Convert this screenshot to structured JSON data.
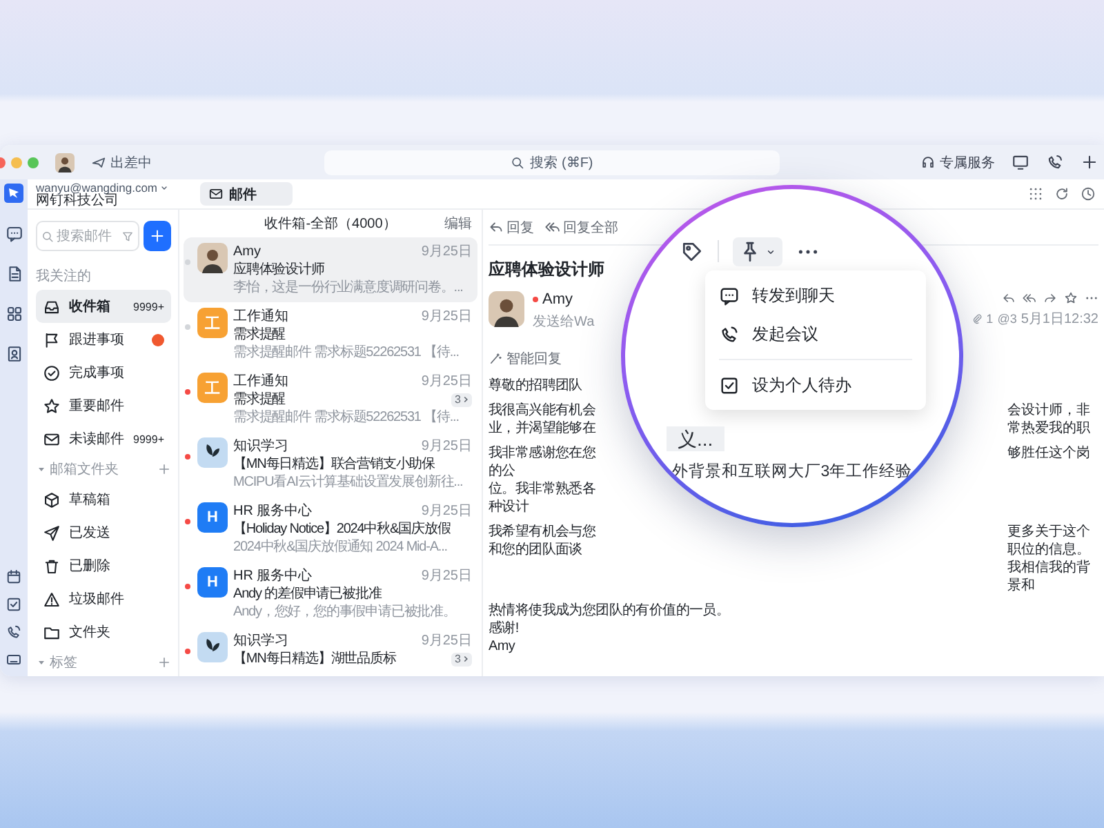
{
  "titlebar": {
    "status": "出差中",
    "search_placeholder": "搜索 (⌘F)",
    "service": "专属服务"
  },
  "account": {
    "email": "wanyu@wangding.com",
    "company": "网钉科技公司",
    "tabs": [
      {
        "label": "邮件",
        "selected": true
      }
    ]
  },
  "sidebar": {
    "search_placeholder": "搜索邮件",
    "sections": [
      {
        "title": "我关注的",
        "collapsible": false,
        "items": [
          {
            "kind": "inbox",
            "label": "收件箱",
            "count": "9999+",
            "alert": false,
            "selected": true
          },
          {
            "kind": "flag",
            "label": "跟进事项",
            "alert": true,
            "selected": false
          },
          {
            "kind": "done",
            "label": "完成事项",
            "alert": false,
            "selected": false
          },
          {
            "kind": "star",
            "label": "重要邮件",
            "alert": false,
            "selected": false
          },
          {
            "kind": "unread",
            "label": "未读邮件",
            "count": "9999+",
            "alert": false,
            "selected": false
          }
        ]
      },
      {
        "title": "邮箱文件夹",
        "collapsible": true,
        "items": [
          {
            "kind": "drafts",
            "label": "草稿箱",
            "alert": false,
            "selected": false
          },
          {
            "kind": "sent",
            "label": "已发送",
            "alert": false,
            "selected": false
          },
          {
            "kind": "trash",
            "label": "已删除",
            "alert": false,
            "selected": false
          },
          {
            "kind": "spam",
            "label": "垃圾邮件",
            "alert": false,
            "selected": false
          },
          {
            "kind": "folder",
            "label": "文件夹",
            "alert": false,
            "selected": false
          }
        ]
      },
      {
        "title": "标签",
        "collapsible": true
      }
    ]
  },
  "mail_list": {
    "title": "收件箱-全部（4000）",
    "edit": "编辑",
    "items": [
      {
        "sender": "Amy",
        "date": "9月25日",
        "subject": "应聘体验设计师",
        "preview": "李怡，这是一份行业满意度调研问卷。...",
        "avatar": {
          "kind": "photo"
        },
        "unread": false,
        "selected": true
      },
      {
        "sender": "工作通知",
        "date": "9月25日",
        "subject": "需求提醒",
        "preview": "需求提醒邮件 需求标题52262531 【待...",
        "avatar": {
          "kind": "letter",
          "text": "工",
          "color": "#f7a133"
        },
        "unread": false,
        "selected": false
      },
      {
        "sender": "工作通知",
        "date": "9月25日",
        "subject": "需求提醒",
        "count": "3",
        "preview": "需求提醒邮件 需求标题52262531 【待...",
        "avatar": {
          "kind": "letter",
          "text": "工",
          "color": "#f7a133"
        },
        "unread": true,
        "selected": false
      },
      {
        "sender": "知识学习",
        "date": "9月25日",
        "subject": "【MN每日精选】联合营销支小助保",
        "preview": "MCIPU看AI云计算基础设置发展创新往...",
        "avatar": {
          "kind": "picture"
        },
        "unread": true,
        "selected": false
      },
      {
        "sender": "HR 服务中心",
        "date": "9月25日",
        "subject": "【Holiday Notice】2024中秋&国庆放假",
        "preview": "2024中秋&国庆放假通知 2024 Mid-A...",
        "avatar": {
          "kind": "letter",
          "text": "H",
          "color": "#1f7cf5"
        },
        "unread": true,
        "selected": false
      },
      {
        "sender": "HR 服务中心",
        "date": "9月25日",
        "subject": "Andy 的差假申请已被批准",
        "preview": "Andy，您好，您的事假申请已被批准。",
        "avatar": {
          "kind": "letter",
          "text": "H",
          "color": "#1f7cf5"
        },
        "unread": true,
        "selected": false
      },
      {
        "sender": "知识学习",
        "date": "9月25日",
        "subject": "【MN每日精选】湖世品质标",
        "count": "3",
        "avatar": {
          "kind": "picture"
        },
        "unread": true,
        "selected": false
      }
    ]
  },
  "reader": {
    "actions": [
      {
        "kind": "reply",
        "label": "回复"
      },
      {
        "kind": "reply_all",
        "label": "回复全部"
      }
    ],
    "subject": "应聘体验设计师",
    "sender": {
      "name": "Amy",
      "recipient": "发送给Wa",
      "unread": true
    },
    "attachments": "1",
    "mentions": "@3",
    "time": "5月1日12:32",
    "smart_reply": "智能回复",
    "body": [
      {
        "left": [
          "尊敬的招聘团队"
        ]
      },
      {
        "left": [
          "我很高兴能有机会",
          "业，并渴望能够在"
        ],
        "right": [
          "会设计师，非常热爱我的职"
        ]
      },
      {
        "left": [
          "我非常感谢您在您的公",
          "位。我非常熟悉各种设计"
        ],
        "right": [
          "够胜任这个岗"
        ]
      },
      {
        "left": [
          "我希望有机会与您和您的团队面谈"
        ],
        "right": [
          "更多关于这个职位的信息。我相信我的背景和"
        ]
      },
      {
        "left": [
          "热情将使我成为您团队的有价值的一员。",
          "感谢!",
          "Amy"
        ]
      }
    ]
  },
  "lens": {
    "menu": [
      [
        {
          "kind": "chat",
          "label": "转发到聊天"
        },
        {
          "kind": "meeting",
          "label": "发起会议"
        }
      ],
      [
        {
          "kind": "todo",
          "label": "设为个人待办"
        }
      ]
    ],
    "zoomed_text": [
      "义...",
      "外背景和互联网大厂3年工作经验"
    ]
  }
}
